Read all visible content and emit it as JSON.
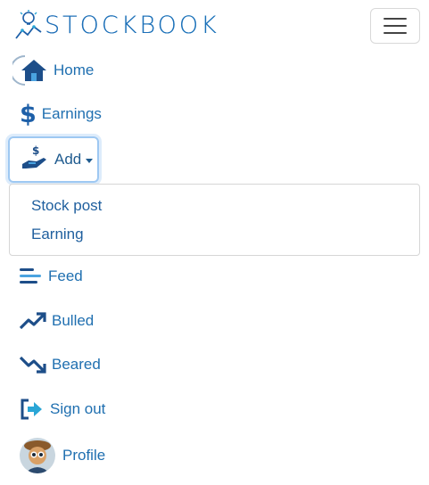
{
  "brand": {
    "name": "STOCKBOOK"
  },
  "nav": {
    "home": "Home",
    "earnings": "Earnings",
    "add": "Add",
    "feed": "Feed",
    "bulled": "Bulled",
    "beared": "Beared",
    "sign_out": "Sign out",
    "profile": "Profile"
  },
  "add_menu": {
    "items": [
      "Stock post",
      "Earning"
    ]
  },
  "colors": {
    "primary": "#1f6fb0",
    "accent": "#2aa6d6",
    "dark": "#1d4e89"
  }
}
